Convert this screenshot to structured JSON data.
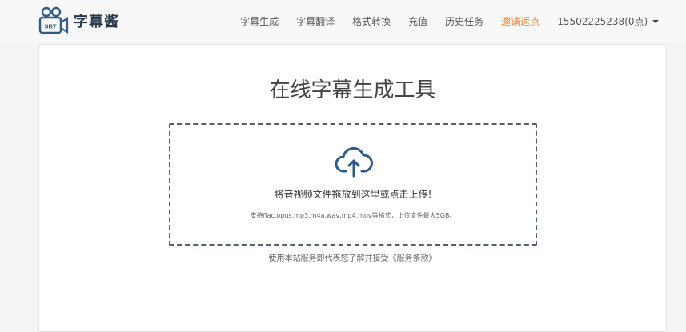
{
  "header": {
    "logo_text": "字幕酱",
    "logo_badge": "SRT",
    "nav": [
      {
        "label": "字幕生成",
        "icon": null
      },
      {
        "label": "字幕翻译"
      },
      {
        "label": "格式转换"
      },
      {
        "label": "充值"
      },
      {
        "label": "历史任务"
      },
      {
        "label": "邀请返点",
        "color": "#e8852c"
      }
    ],
    "account": "15502225238(0点)"
  },
  "main": {
    "title": "在线字幕生成工具",
    "dropzone": {
      "icon": "cloud-upload-icon",
      "main_text": "将音视频文件拖放到这里或点击上传!",
      "sub_text": "支持flac,opus,mp3,m4a,wav,mp4,mov等格式，上传文件最大5GB。"
    },
    "terms_text": "使用本站服务即代表您了解并接受《服务条款》"
  },
  "colors": {
    "accent": "#e8852c",
    "logo_blue": "#2f5c86",
    "dashed_border": "#4f5f75"
  }
}
